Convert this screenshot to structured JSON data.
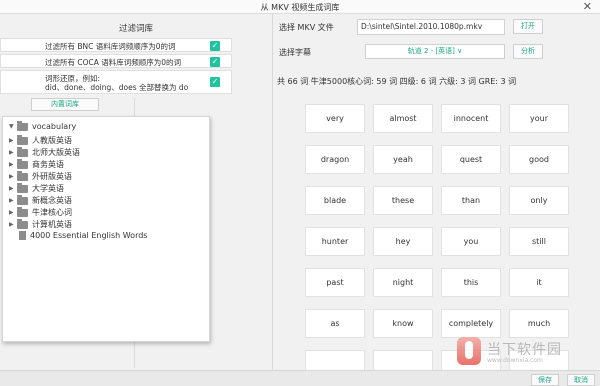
{
  "window": {
    "title": "从 MKV 视频生成词库",
    "close_glyph": "✕"
  },
  "filter": {
    "header": "过滤词库",
    "options": [
      {
        "label": "过滤所有 BNC    语料库词频顺序为0的词",
        "checked": true
      },
      {
        "label": "过滤所有 COCA  语料库词频顺序为0的词",
        "checked": true
      },
      {
        "label": "词形还原，例如:",
        "label2": "did、done、doing、does 全部替换为 do",
        "checked": true
      }
    ],
    "builtin_button": "内置词库"
  },
  "tree": {
    "root": "vocabulary",
    "folders": [
      "人教版英语",
      "北师大版英语",
      "商务英语",
      "外研版英语",
      "大学英语",
      "新概念英语",
      "牛津核心词",
      "计算机英语"
    ],
    "file": "4000 Essential English Words"
  },
  "right": {
    "select_mkv_label": "选择 MKV 文件",
    "mkv_path": "D:\\sintel\\Sintel.2010.1080p.mkv",
    "open_button": "打开",
    "select_subtitle_label": "选择字幕",
    "subtitle_value": "轨道 2 - [英语] ∨",
    "analyze_button": "分析",
    "stats": "共 66 词  牛津5000核心词: 59 词  四级: 6 词  六级: 3 词  GRE: 3 词",
    "words": [
      "very",
      "almost",
      "innocent",
      "your",
      "dragon",
      "yeah",
      "quest",
      "good",
      "blade",
      "these",
      "than",
      "only",
      "hunter",
      "hey",
      "you",
      "still",
      "past",
      "night",
      "this",
      "it",
      "as",
      "know",
      "completely",
      "much"
    ]
  },
  "footer": {
    "save_button": "保存",
    "cancel_button": "取消"
  },
  "watermark": {
    "title": "当下软件园",
    "url": "www.downxia.com"
  },
  "colors": {
    "accent": "#1aa784",
    "checkbox": "#21c2a0"
  }
}
